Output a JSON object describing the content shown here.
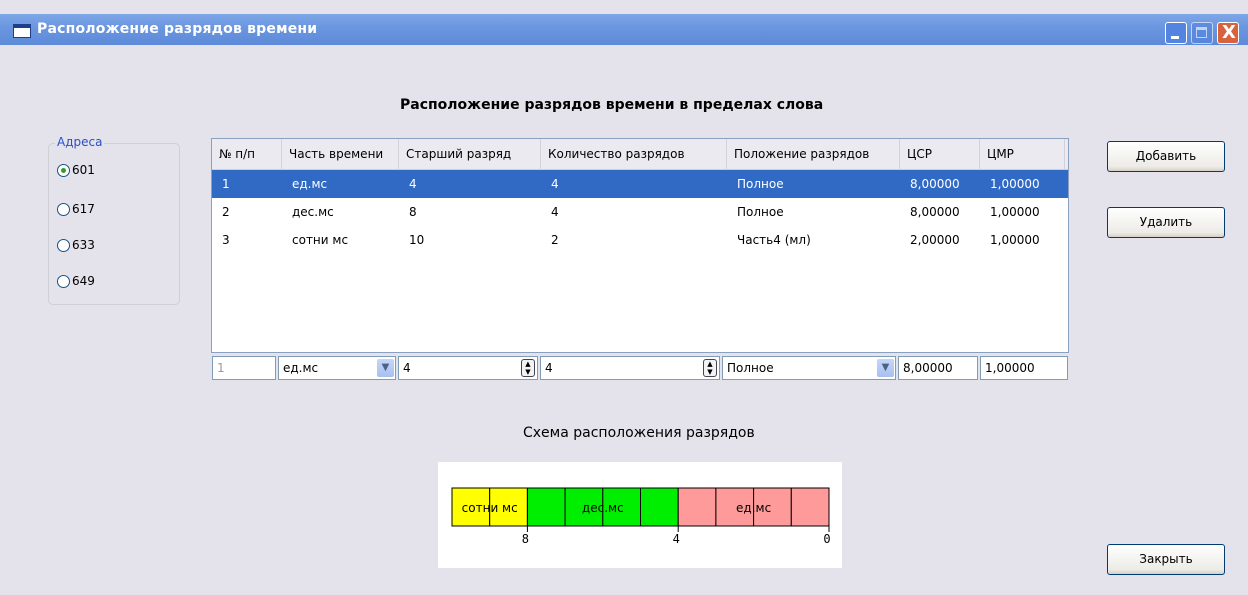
{
  "window": {
    "title": "Расположение разрядов времени",
    "close_glyph": "X"
  },
  "heading": "Расположение разрядов времени в пределах слова",
  "addresses": {
    "title": "Адреса",
    "items": [
      {
        "label": "601",
        "checked": true
      },
      {
        "label": "617",
        "checked": false
      },
      {
        "label": "633",
        "checked": false
      },
      {
        "label": "649",
        "checked": false
      }
    ]
  },
  "table": {
    "headers": [
      "№ п/п",
      "Часть времени",
      "Старший разряд",
      "Количество разрядов",
      "Положение разрядов",
      "ЦСР",
      "ЦМР"
    ],
    "rows": [
      [
        "1",
        "ед.мс",
        "4",
        "4",
        "Полное",
        "8,00000",
        "1,00000"
      ],
      [
        "2",
        "дес.мс",
        "8",
        "4",
        "Полное",
        "8,00000",
        "1,00000"
      ],
      [
        "3",
        "сотни мс",
        "10",
        "2",
        "Часть4 (мл)",
        "2,00000",
        "1,00000"
      ]
    ],
    "selected_row": 0
  },
  "editor": {
    "index": "1",
    "part": "ед.мс",
    "high_bit": "4",
    "count": "4",
    "position": "Полное",
    "csr": "8,00000",
    "cmr": "1,00000"
  },
  "buttons": {
    "add": "Добавить",
    "delete": "Удалить",
    "close": "Закрыть"
  },
  "scheme": {
    "label": "Схема расположения разрядов",
    "segments": [
      {
        "label": "сотни мс",
        "color": "#ffff00",
        "bits": 2
      },
      {
        "label": "дес.мс",
        "color": "#00ee00",
        "bits": 4
      },
      {
        "label": "ед.мс",
        "color": "#ff9a9a",
        "bits": 4
      }
    ],
    "ticks": [
      "8",
      "4",
      "0"
    ]
  },
  "colors": {
    "selection": "#316ac5",
    "title_accent": "#2850c8"
  }
}
